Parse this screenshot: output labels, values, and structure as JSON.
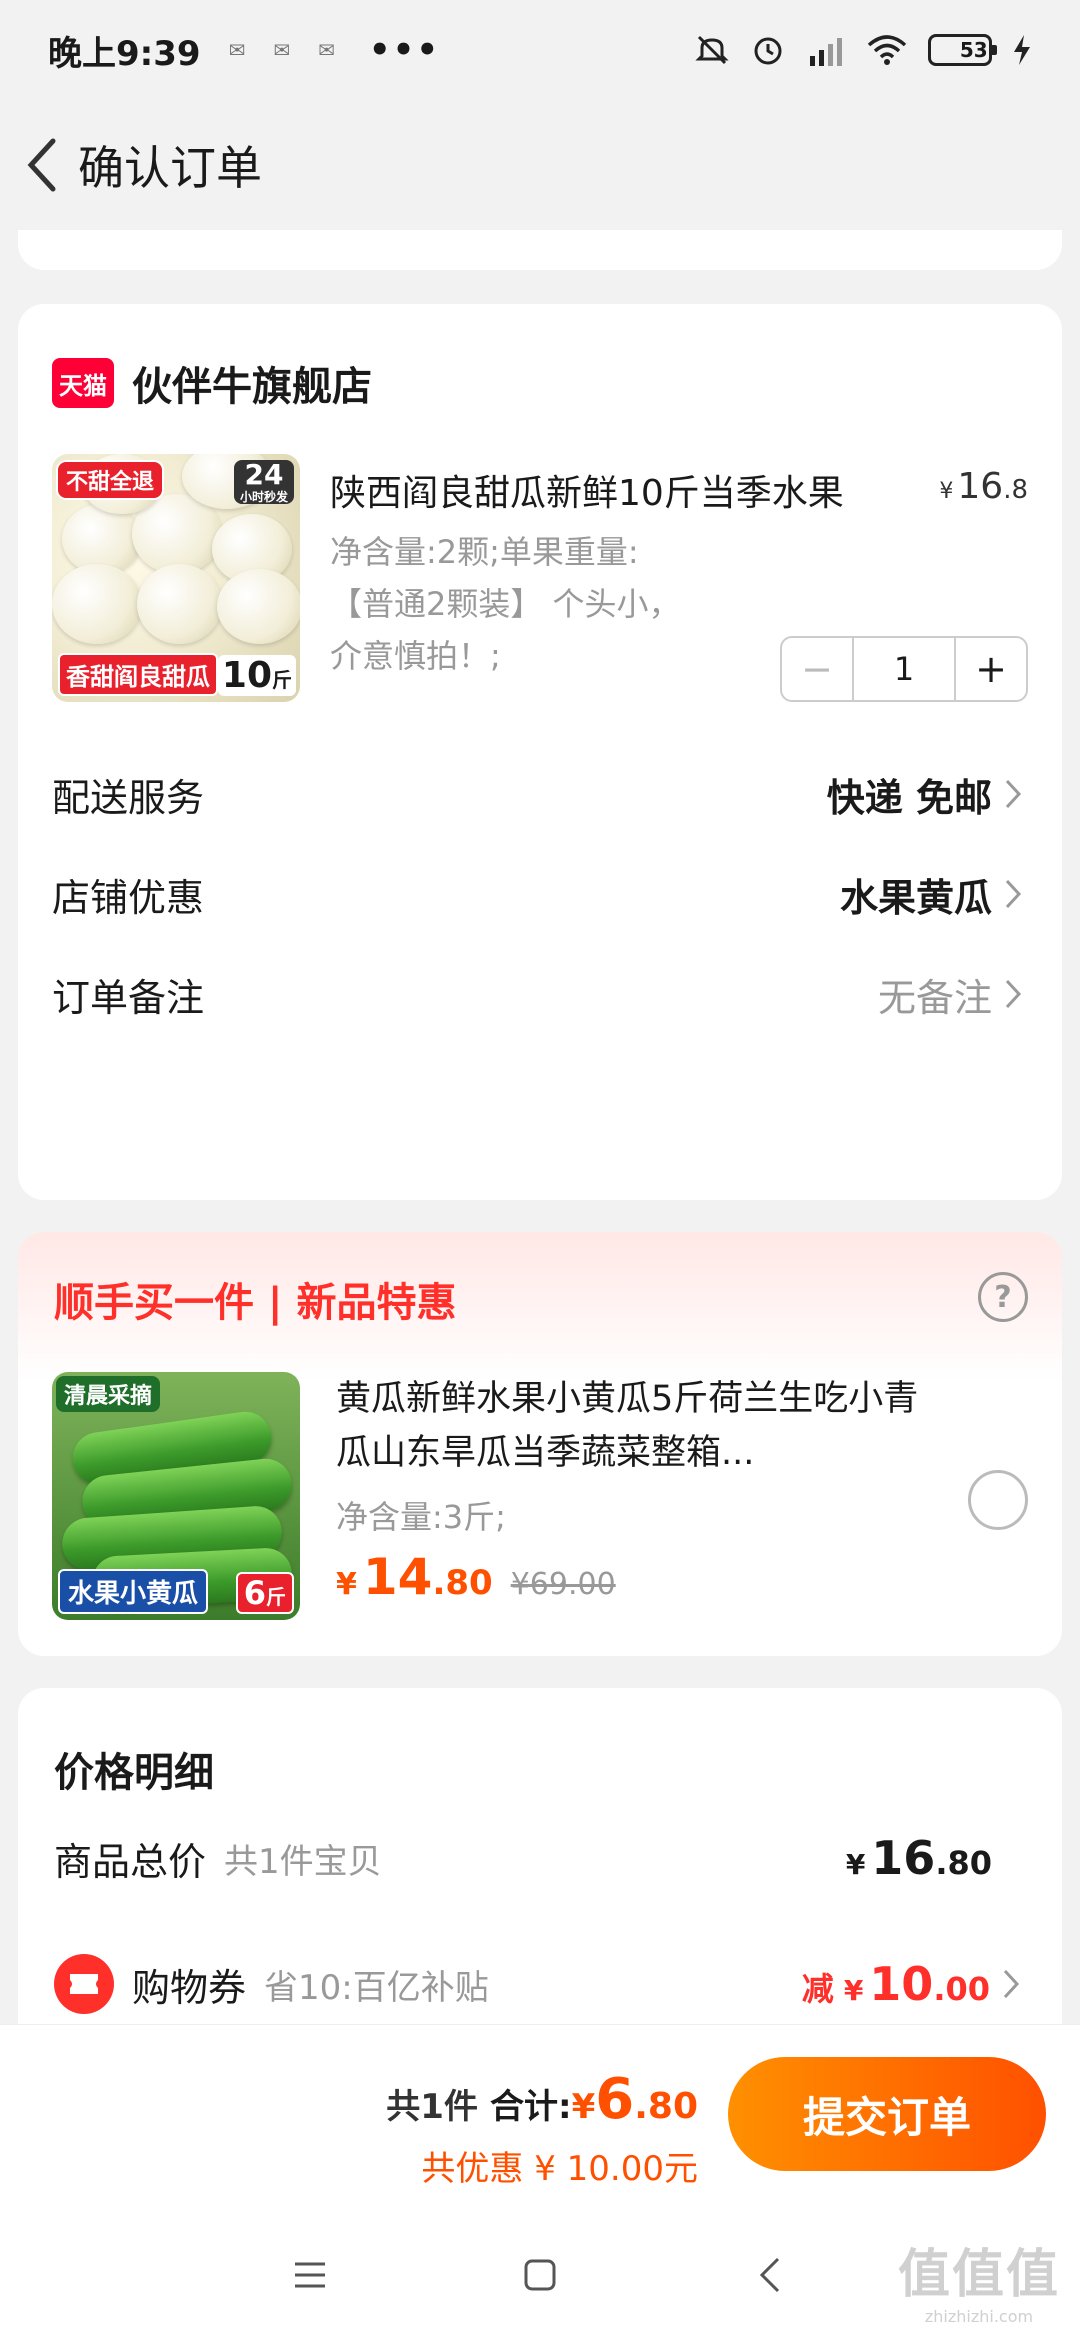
{
  "status_bar": {
    "time": "晚上9:39",
    "more": "•••",
    "battery": "53",
    "battery_level": 0.53,
    "icons": [
      "wechat-icon",
      "wechat-icon",
      "qq-icon",
      "mute-icon",
      "alarm-icon",
      "signal-icon",
      "wifi-icon",
      "battery-icon",
      "charging-icon"
    ]
  },
  "header": {
    "title": "确认订单"
  },
  "shop": {
    "logo_text": "天猫",
    "name": "伙伴牛旗舰店",
    "product": {
      "title": "陕西阎良甜瓜新鲜10斤当季水果",
      "price_yen": "¥",
      "price_int": "16",
      "price_dec": ".8",
      "spec_lines": [
        "净含量:2颗;单果重量:",
        "【普通2颗装】 个头小，",
        "介意慎拍！;"
      ],
      "image_badges": {
        "return": "不甜全退",
        "hours": "24",
        "hours_sub": "小时秒发",
        "name_tag": "香甜阎良甜瓜",
        "weight": "10",
        "weight_unit": "斤"
      },
      "quantity": "1",
      "minus": "−",
      "plus": "+"
    },
    "rows": [
      {
        "label": "配送服务",
        "value": "快递 免邮"
      },
      {
        "label": "店铺优惠",
        "value": "水果黄瓜"
      },
      {
        "label": "订单备注",
        "value": "无备注"
      }
    ]
  },
  "addon": {
    "title": "顺手买一件 | 新品特惠",
    "help": "?",
    "image_badges": {
      "top": "清晨采摘",
      "bottom": "水果小黄瓜",
      "weight": "6",
      "weight_unit": "斤"
    },
    "name": "黄瓜新鲜水果小黄瓜5斤荷兰生吃小青瓜山东旱瓜当季蔬菜整箱...",
    "spec": "净含量:3斤;",
    "price_yen": "¥",
    "price_int": "14",
    "price_dec": ".80",
    "orig_price": "¥69.00",
    "selected": false
  },
  "price_detail": {
    "title": "价格明细",
    "goods_label": "商品总价",
    "goods_sub": "共1件宝贝",
    "goods_yen": "¥",
    "goods_int": "16",
    "goods_dec": ".80",
    "coupon_label": "购物券",
    "coupon_sub": "省10:百亿补贴",
    "coupon_pre": "减",
    "coupon_yen": "¥",
    "coupon_int": "10",
    "coupon_dec": ".00"
  },
  "bottom_bar": {
    "count": "共1件",
    "total_label": "合计:",
    "total_yen": "¥",
    "total_int": "6",
    "total_dec": ".80",
    "discount": "共优惠 ¥ 10.00元",
    "submit": "提交订单"
  },
  "watermark": {
    "big": "值值值",
    "small": "zhizhizhi.com"
  },
  "colors": {
    "accent": "#ff5000",
    "red": "#ff2f2a",
    "tmall": "#ff0036"
  }
}
